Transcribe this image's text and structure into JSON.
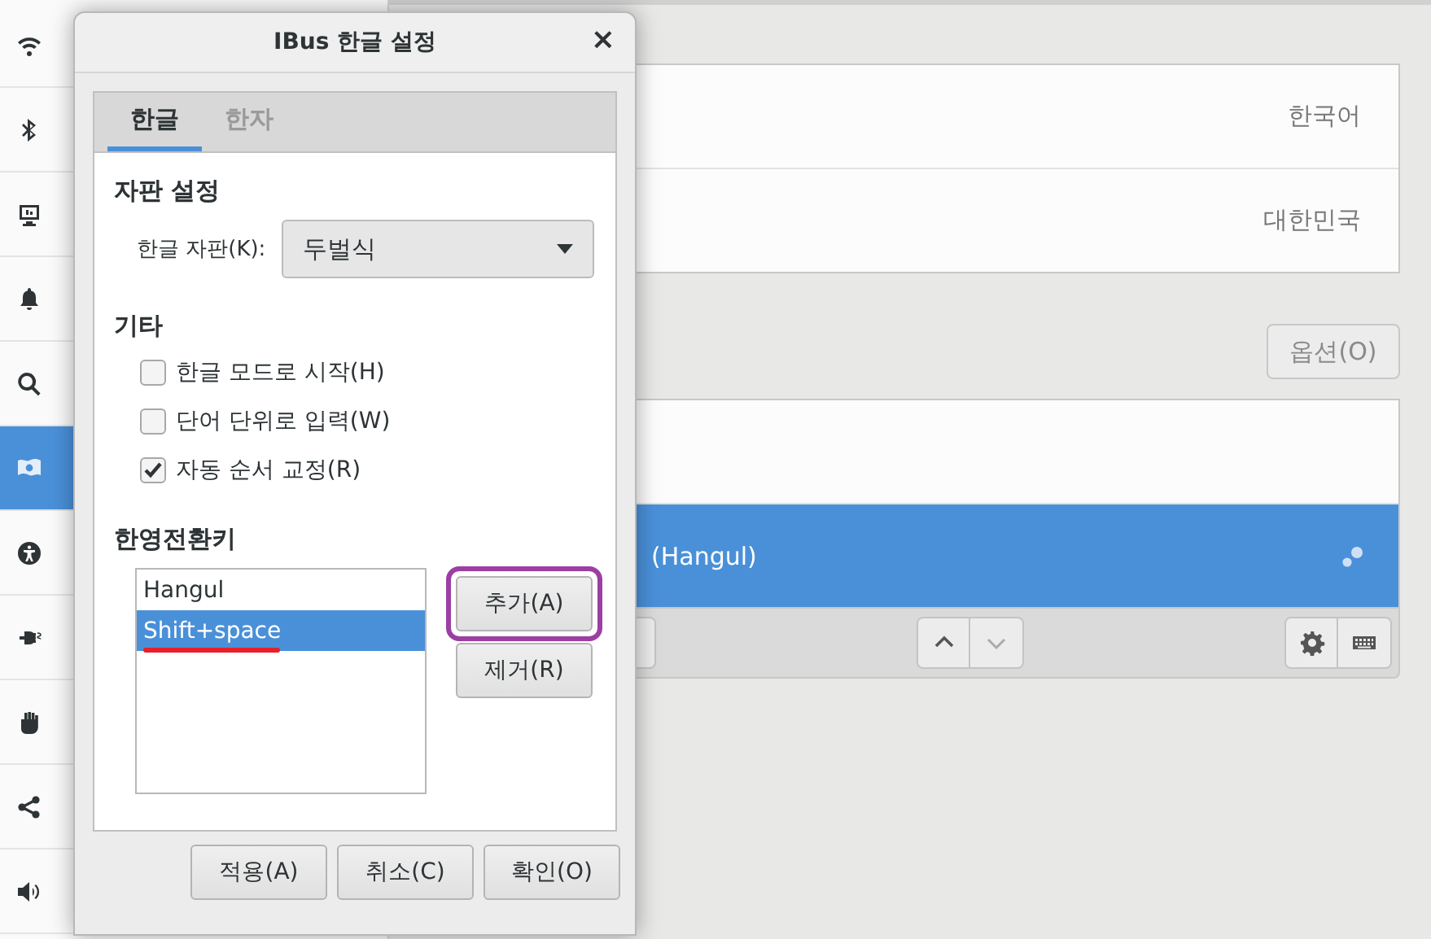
{
  "sidebar": {
    "items": [
      {
        "kind": "wifi",
        "selected": false
      },
      {
        "kind": "bluetooth",
        "selected": false
      },
      {
        "kind": "display",
        "selected": false
      },
      {
        "kind": "bell",
        "selected": false
      },
      {
        "kind": "search",
        "selected": false
      },
      {
        "kind": "flag",
        "selected": true
      },
      {
        "kind": "accessibility",
        "selected": false
      },
      {
        "kind": "plug",
        "selected": false
      },
      {
        "kind": "hand",
        "selected": false
      },
      {
        "kind": "share",
        "selected": false
      },
      {
        "kind": "speaker",
        "selected": false
      }
    ]
  },
  "language_card": {
    "rows": [
      {
        "value": "한국어"
      },
      {
        "value": "대한민국"
      }
    ]
  },
  "options_button": "옵션(O)",
  "input_sources": {
    "rows": [
      {
        "selected": false
      },
      {
        "label": "(Hangul)",
        "selected": true
      }
    ]
  },
  "dialog": {
    "title": "IBus 한글 설정",
    "close": "×",
    "tabs": [
      {
        "label": "한글",
        "selected": true
      },
      {
        "label": "한자",
        "selected": false
      }
    ],
    "keyboard_section": {
      "heading": "자판 설정",
      "label": "한글 자판(K):",
      "dropdown": "두벌식"
    },
    "misc_section": {
      "heading": "기타",
      "options": [
        {
          "label": "한글 모드로 시작(H)",
          "checked": false
        },
        {
          "label": "단어 단위로 입력(W)",
          "checked": false
        },
        {
          "label": "자동 순서 교정(R)",
          "checked": true
        }
      ]
    },
    "hotkey_section": {
      "heading": "한영전환키",
      "keys": [
        {
          "label": "Hangul",
          "selected": false
        },
        {
          "label": "Shift+space",
          "selected": true
        }
      ],
      "add_button": "추가(A)",
      "remove_button": "제거(R)"
    },
    "buttons": [
      "적용(A)",
      "취소(C)",
      "확인(O)"
    ]
  }
}
